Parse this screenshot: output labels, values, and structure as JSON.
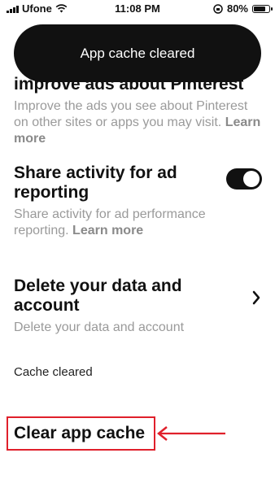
{
  "status_bar": {
    "carrier": "Ufone",
    "time": "11:08 PM",
    "battery": "80%",
    "battery_level": 0.8
  },
  "toast": {
    "message": "App cache cleared"
  },
  "settings": {
    "ads_item": {
      "title": "improve ads about Pinterest",
      "description": "Improve the ads you see about Pinterest on other sites or apps you may visit.",
      "learn_more": "Learn more"
    },
    "share_activity": {
      "title": "Share activity for ad reporting",
      "description": "Share activity for ad performance reporting.",
      "learn_more": "Learn more",
      "toggle_on": true
    },
    "delete_account": {
      "title": "Delete your data and account",
      "description": "Delete your data and account"
    },
    "cache_status": "Cache cleared",
    "clear_cache_label": "Clear app cache"
  },
  "colors": {
    "highlight": "#e0202b",
    "toggle": "#111111",
    "muted_text": "#9a9a9a"
  }
}
